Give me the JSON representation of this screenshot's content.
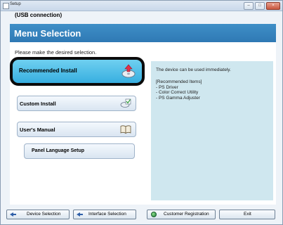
{
  "window": {
    "title": "Setup",
    "buttons": {
      "minimize": "–",
      "maximize": "□",
      "close": "×"
    }
  },
  "subtitle": "(USB connection)",
  "banner": {
    "title": "Menu Selection"
  },
  "prompt": "Please make the desired selection.",
  "menu": {
    "recommended": "Recommended Install",
    "custom": "Custom Install",
    "manual": "User's Manual",
    "panel_language": "Panel Language Setup"
  },
  "info": {
    "main": "The device can be used immediately.",
    "heading": "[Recommended Items]",
    "items": [
      "- PS Driver",
      "- Color Correct Utility",
      "- PS Gamma Adjuster"
    ]
  },
  "bottom": {
    "device_selection": "Device Selection",
    "interface_selection": "Interface Selection",
    "customer_registration": "Customer Registration",
    "exit": "Exit"
  },
  "icons": {
    "recommended": "cd-install-icon",
    "custom": "cd-check-icon",
    "manual": "book-icon",
    "back": "back-arrow-icon",
    "registration": "globe-icon"
  },
  "colors": {
    "banner": "#3f8fc7",
    "selected": "#4fc0ea",
    "info_bg": "#cfe7ef"
  }
}
